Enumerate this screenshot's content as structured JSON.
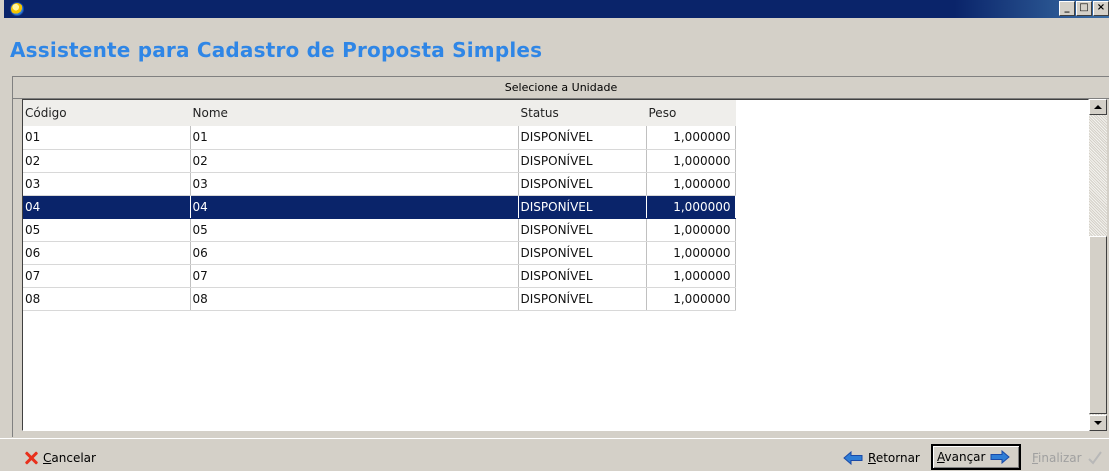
{
  "window": {
    "title": "Assistente para Cadastro de Proposta Simples",
    "controls": {
      "minimize": "_",
      "maximize": "□",
      "close": "×"
    }
  },
  "panel": {
    "caption": "Selecione a Unidade"
  },
  "grid": {
    "columns": [
      "Código",
      "Nome",
      "Status",
      "Peso"
    ],
    "rows": [
      {
        "codigo": "01",
        "nome": "01",
        "status": "DISPONÍVEL",
        "peso": "1,000000"
      },
      {
        "codigo": "02",
        "nome": "02",
        "status": "DISPONÍVEL",
        "peso": "1,000000"
      },
      {
        "codigo": "03",
        "nome": "03",
        "status": "DISPONÍVEL",
        "peso": "1,000000"
      },
      {
        "codigo": "04",
        "nome": "04",
        "status": "DISPONÍVEL",
        "peso": "1,000000"
      },
      {
        "codigo": "05",
        "nome": "05",
        "status": "DISPONÍVEL",
        "peso": "1,000000"
      },
      {
        "codigo": "06",
        "nome": "06",
        "status": "DISPONÍVEL",
        "peso": "1,000000"
      },
      {
        "codigo": "07",
        "nome": "07",
        "status": "DISPONÍVEL",
        "peso": "1,000000"
      },
      {
        "codigo": "08",
        "nome": "08",
        "status": "DISPONÍVEL",
        "peso": "1,000000"
      }
    ],
    "selected_row": 3
  },
  "footer": {
    "cancel": {
      "hotkey": "C",
      "rest": "ancelar",
      "icon": "x-icon"
    },
    "retornar": {
      "hotkey": "R",
      "rest": "etornar",
      "icon": "arrow-left-icon"
    },
    "avancar": {
      "hotkey": "A",
      "rest": "vançar",
      "icon": "arrow-right-icon"
    },
    "finalizar": {
      "hotkey": "F",
      "rest": "inalizar",
      "icon": "check-icon",
      "enabled": false
    }
  },
  "colors": {
    "title_text": "#2f86e6",
    "titlebar": "#0a246a",
    "selection": "#0a246a",
    "cancel_icon": "#e8301c",
    "arrow_icon": "#2f7dd6"
  }
}
